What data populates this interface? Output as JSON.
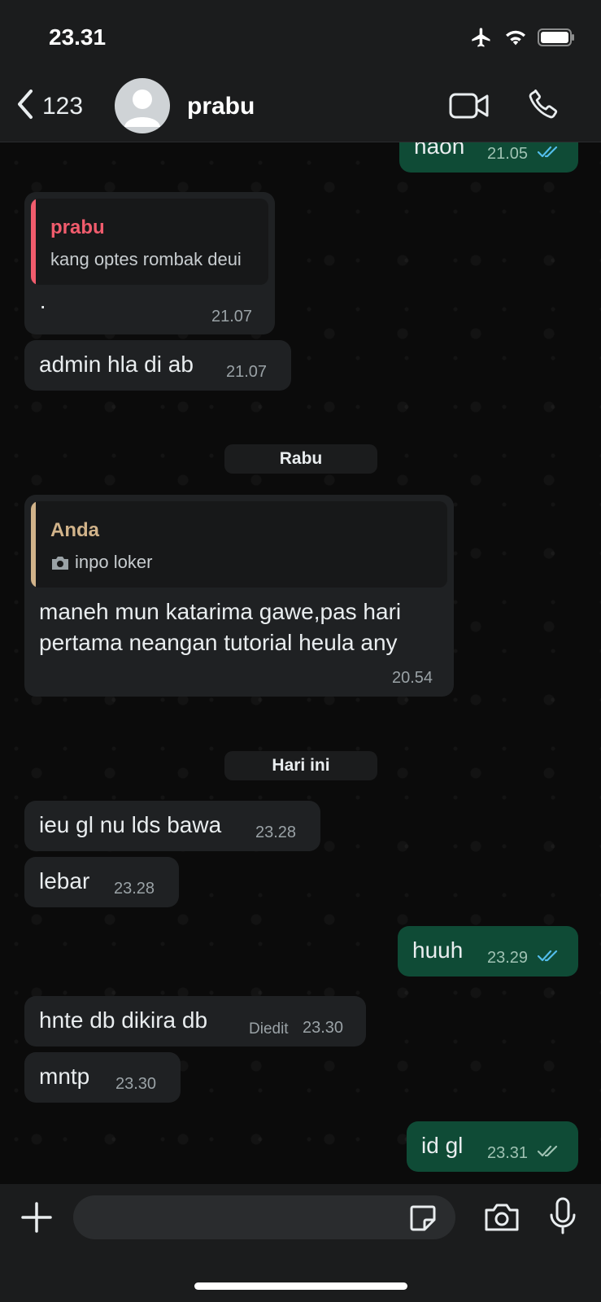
{
  "status": {
    "time": "23.31"
  },
  "header": {
    "back_count": "123",
    "contact_name": "prabu"
  },
  "messages": [
    {
      "text": "naon",
      "time": "21.05"
    },
    {
      "quote_author": "prabu",
      "quote_text": "kang optes rombak deui",
      "text": "·",
      "time": "21.07"
    },
    {
      "text": "admin hla di ab",
      "time": "21.07"
    },
    {
      "date_label": "Rabu"
    },
    {
      "quote_author": "Anda",
      "quote_text": "inpo loker",
      "text_line1": "maneh mun katarima gawe,pas hari",
      "text_line2": "pertama neangan tutorial heula any",
      "time": "20.54"
    },
    {
      "date_label": "Hari ini"
    },
    {
      "text": "ieu gl nu lds bawa",
      "time": "23.28"
    },
    {
      "text": "lebar",
      "time": "23.28"
    },
    {
      "text": "huuh",
      "time": "23.29"
    },
    {
      "text": "hnte db dikira db",
      "edited": "Diedit",
      "time": "23.30"
    },
    {
      "text": "mntp",
      "time": "23.30"
    },
    {
      "text": "id gl",
      "time": "23.31"
    }
  ],
  "colors": {
    "incoming_bubble": "#1f2123",
    "outgoing_bubble": "#0f4b36",
    "read_tick": "#53bdeb",
    "quote_prabu": "#f15c6d",
    "quote_anda": "#d1b38a"
  },
  "icons": [
    "airplane-icon",
    "wifi-icon",
    "battery-icon",
    "back-chevron-icon",
    "avatar-icon",
    "video-call-icon",
    "phone-call-icon",
    "plus-icon",
    "sticker-icon",
    "camera-icon",
    "mic-icon"
  ]
}
